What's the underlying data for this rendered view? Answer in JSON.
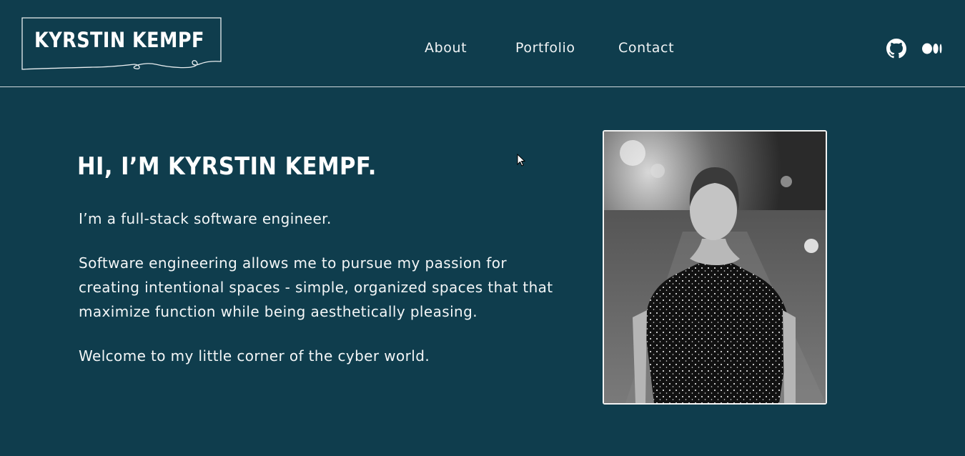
{
  "header": {
    "logo_text": "KYRSTIN KEMPF",
    "nav": [
      {
        "label": "About"
      },
      {
        "label": "Portfolio"
      },
      {
        "label": "Contact"
      }
    ],
    "social_icons": [
      "github-icon",
      "medium-icon"
    ]
  },
  "hero": {
    "title": "HI, I’M KYRSTIN KEMPF.",
    "paragraphs": [
      "I’m a full-stack software engineer.",
      "Software engineering allows me to pursue my passion for creating intentional spaces - simple, organized spaces that that maximize function while being aesthetically pleasing.",
      "Welcome to my little corner of the cyber world."
    ],
    "photo": "portrait-photo"
  },
  "colors": {
    "background": "#0f3d4d",
    "text": "#ffffff",
    "divider": "#cfd9dd"
  }
}
